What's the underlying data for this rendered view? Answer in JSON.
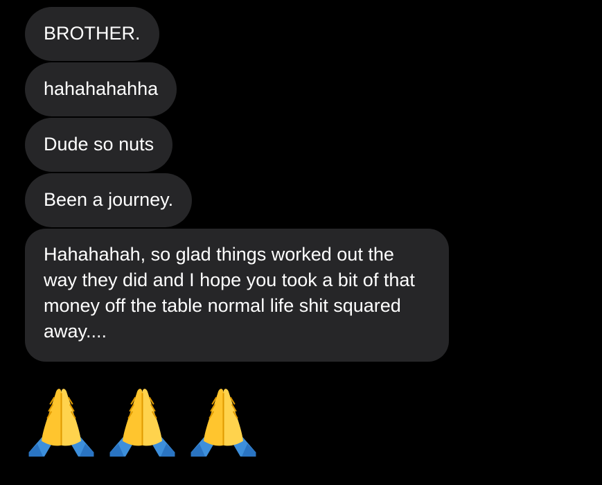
{
  "messages": [
    {
      "text": "BROTHER."
    },
    {
      "text": "hahahahahha"
    },
    {
      "text": "Dude so nuts"
    },
    {
      "text": "Been a journey."
    },
    {
      "text": "Hahahahah, so glad things worked out the way they did and I hope you took a bit of that money off the table normal life shit squared away...."
    }
  ],
  "emoji_message": {
    "icons": [
      "folded-hands-icon",
      "folded-hands-icon",
      "folded-hands-icon"
    ]
  },
  "colors": {
    "background": "#000000",
    "bubble": "#262628",
    "text": "#ffffff",
    "emoji_skin": "#FFC52E",
    "emoji_sleeve": "#3D8FDB"
  }
}
